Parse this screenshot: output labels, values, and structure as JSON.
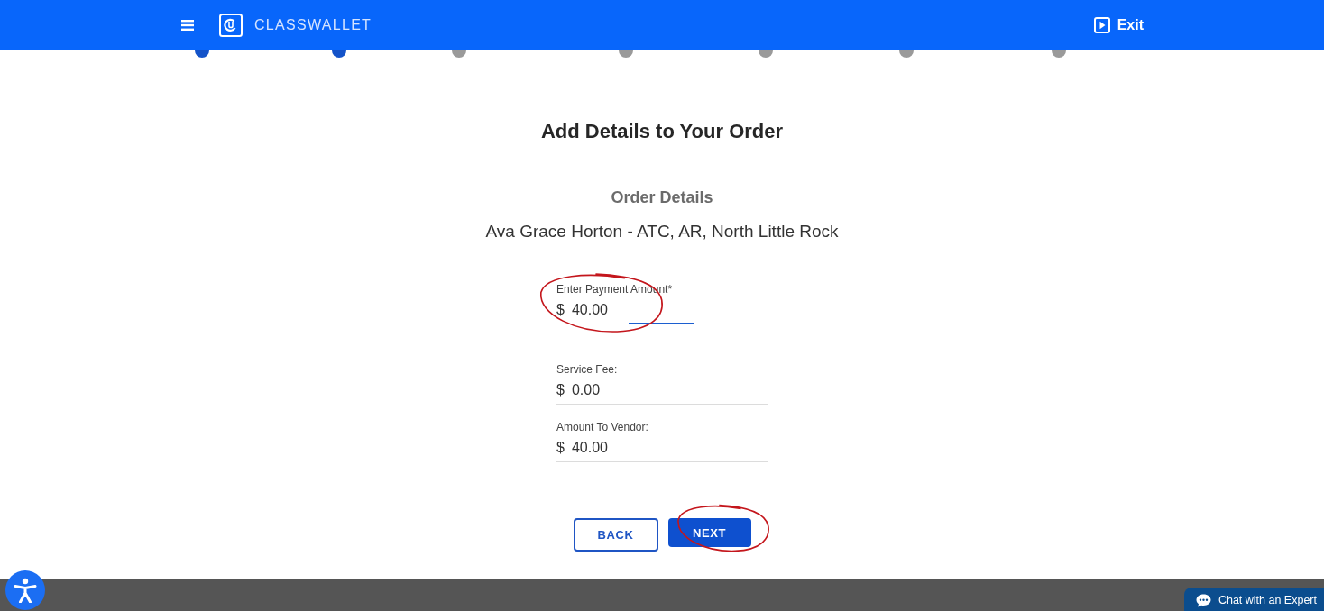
{
  "header": {
    "brand": "CLASSWALLET",
    "exit_label": "Exit"
  },
  "stepper": {
    "steps": [
      {
        "color": "#1453c9"
      },
      {
        "color": "#1453c9"
      },
      {
        "color": "#9a9a9a"
      },
      {
        "color": "#9a9a9a"
      },
      {
        "color": "#9a9a9a"
      },
      {
        "color": "#9a9a9a"
      },
      {
        "color": "#9a9a9a"
      }
    ]
  },
  "page": {
    "title": "Add Details to Your Order",
    "section_title": "Order Details",
    "order_name": "Ava Grace Horton - ATC, AR, North Little Rock"
  },
  "form": {
    "fields": [
      {
        "label": "Enter Payment Amount*",
        "prefix": "$",
        "value": "40.00",
        "focused": true,
        "circled": true
      },
      {
        "label": "Service Fee:",
        "prefix": "$",
        "value": "0.00",
        "focused": false,
        "circled": false
      },
      {
        "label": "Amount To Vendor:",
        "prefix": "$",
        "value": "40.00",
        "focused": false,
        "circled": false
      }
    ]
  },
  "buttons": [
    {
      "label": "BACK",
      "kind": "secondary",
      "circled": false
    },
    {
      "label": "NEXT",
      "kind": "primary",
      "circled": true
    }
  ],
  "chat_button": {
    "label": "Chat with an Expert"
  }
}
